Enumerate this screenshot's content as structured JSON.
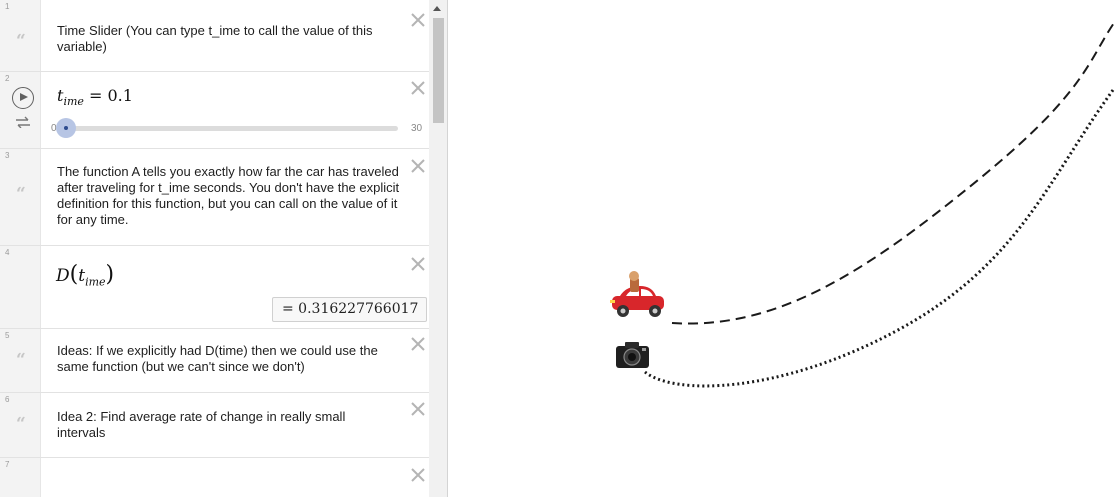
{
  "algebra": {
    "rows": [
      {
        "number": "1",
        "text": "Time Slider (You can type t_ime to call the value of this variable)"
      },
      {
        "number": "2",
        "var": "t",
        "sub": "ime",
        "equals": "= 0.1",
        "slider_min": "0",
        "slider_max": "30",
        "slider_fraction": 0.0033
      },
      {
        "number": "3",
        "text": "The function A tells you exactly how far the car has traveled after traveling for t_ime seconds. You don't have the explicit definition for this function, but you can call on the value of it for any time."
      },
      {
        "number": "4",
        "func": "D",
        "arg": "t",
        "sub": "ime",
        "result": "=  0.316227766017"
      },
      {
        "number": "5",
        "text": "Ideas: If we explicitly had D(time) then we could use the same function (but we can't since we don't)"
      },
      {
        "number": "6",
        "text": "Idea 2: Find average rate of change in really small intervals"
      },
      {
        "number": "7"
      }
    ],
    "quote_glyph": "“"
  },
  "graphics": {
    "objects": [
      "car-icon",
      "camera-icon"
    ],
    "car_color": "#d8262b",
    "curve_color": "#111111"
  }
}
